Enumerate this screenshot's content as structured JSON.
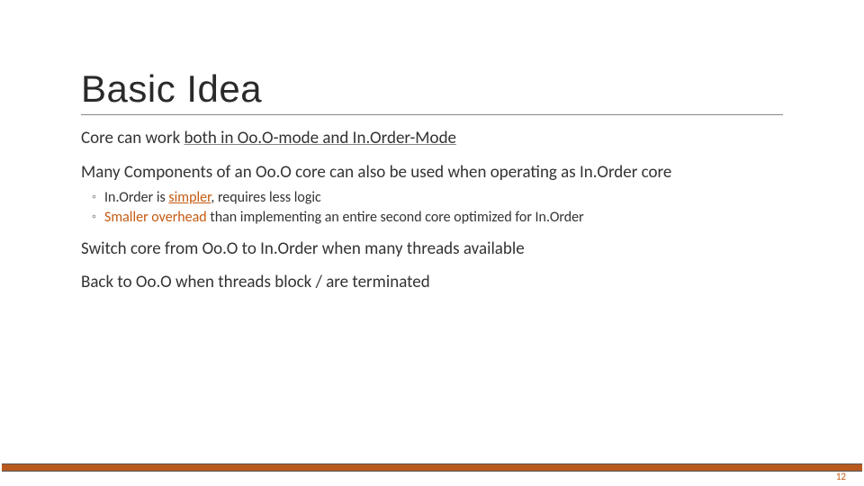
{
  "title": "Basic Idea",
  "line1_pre": "Core can work ",
  "line1_ul": "both in Oo.O-mode and In.Order-Mode",
  "line2": "Many Components of an Oo.O core can also be used when operating as In.Order core",
  "sub1_pre": "In.Order is ",
  "sub1_hl": "simpler",
  "sub1_post": ", requires less logic",
  "sub2_hl": "Smaller overhead",
  "sub2_post": " than implementing an entire second core optimized for In.Order",
  "line3": "Switch core from Oo.O to In.Order when many threads available",
  "line4": "Back to Oo.O when threads block / are terminated",
  "page_number": "12",
  "colors": {
    "accent": "#c55a11",
    "footer_bar": "#b85a1e"
  }
}
